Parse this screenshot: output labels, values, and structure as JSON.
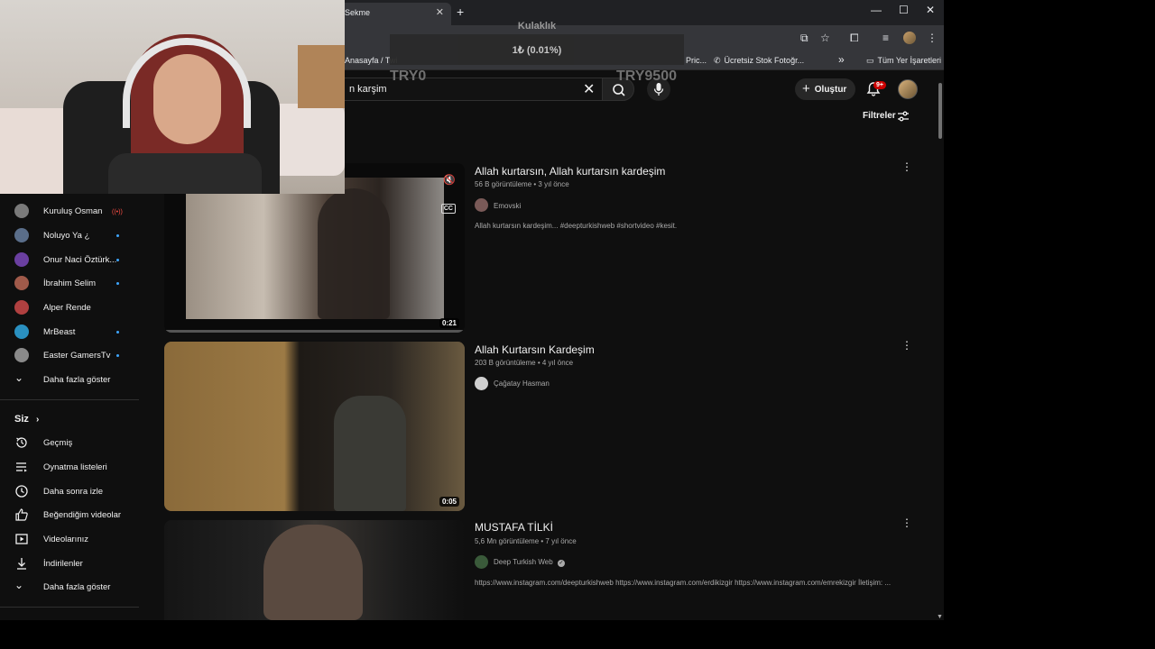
{
  "browser": {
    "tab_title": "Sekme",
    "bookmarks": [
      "Anasayfa / Twi",
      "Pric...",
      "Ücretsiz Stok Fotoğr...",
      "»",
      "Tüm Yer İşaretleri"
    ]
  },
  "overlay": {
    "title": "Kulaklık",
    "amount": "1₺ (0.01%)",
    "min_label": "TRY0",
    "max_label": "TRY9500"
  },
  "header": {
    "search_value": "n karşim",
    "create_label": "Oluştur",
    "notifications_badge": "9+",
    "filters_label": "Filtreler"
  },
  "sidebar": {
    "subscriptions": [
      {
        "label": "Kuruluş Osman",
        "indicator": "live",
        "color": "#7a7a7a"
      },
      {
        "label": "Noluyo Ya ¿",
        "indicator": "dot",
        "color": "#5a6e8a"
      },
      {
        "label": "Onur Naci Öztürk...",
        "indicator": "dot",
        "color": "#6a3fa0"
      },
      {
        "label": "İbrahim Selim",
        "indicator": "dot",
        "color": "#a05a4a"
      },
      {
        "label": "Alper Rende",
        "indicator": "none",
        "color": "#b04040"
      },
      {
        "label": "MrBeast",
        "indicator": "dot",
        "color": "#2a90c0"
      },
      {
        "label": "Easter GamersTv",
        "indicator": "dot",
        "color": "#8a8a8a"
      }
    ],
    "show_more_1": "Daha fazla göster",
    "you_label": "Siz",
    "you_items": [
      {
        "label": "Geçmiş",
        "icon": "history-icon"
      },
      {
        "label": "Oynatma listeleri",
        "icon": "playlist-icon"
      },
      {
        "label": "Daha sonra izle",
        "icon": "clock-icon"
      },
      {
        "label": "Beğendiğim videolar",
        "icon": "thumbs-up-icon"
      },
      {
        "label": "Videolarınız",
        "icon": "video-icon"
      },
      {
        "label": "İndirilenler",
        "icon": "download-icon"
      }
    ],
    "show_more_2": "Daha fazla göster"
  },
  "results": [
    {
      "title": "Allah kurtarsın, Allah kurtarsın kardeşim",
      "meta": "56 B görüntüleme • 3 yıl önce",
      "channel": "Emovski",
      "description": "Allah kurtarsın kardeşim... #deepturkishweb #shortvideo #kesit.",
      "duration": "0:21",
      "cc": "CC"
    },
    {
      "title": "Allah Kurtarsın Kardeşim",
      "meta": "203 B görüntüleme • 4 yıl önce",
      "channel": "Çağatay Hasman",
      "description": "",
      "duration": "0:05"
    },
    {
      "title": "MUSTAFA TİLKİ",
      "meta": "5,6 Mn görüntüleme • 7 yıl önce",
      "channel": "Deep Turkish Web",
      "verified": "✓",
      "description": "https://www.instagram.com/deepturkishweb https://www.instagram.com/erdikizgir https://www.instagram.com/emrekizgir İletişim: ...",
      "duration": ""
    }
  ]
}
